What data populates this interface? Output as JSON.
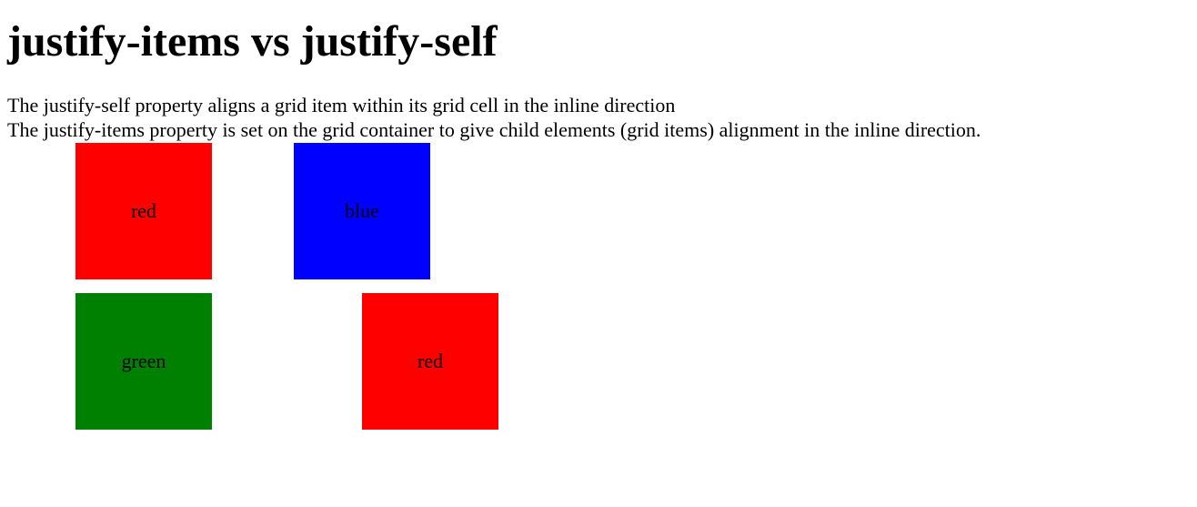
{
  "page": {
    "heading": "justify-items vs justify-self",
    "descriptions": {
      "justify_self": "The justify-self property aligns a grid item within its grid cell in the inline direction",
      "justify_items": "The justify-items property is set on the grid container to give child elements (grid items) alignment in the inline direction."
    }
  },
  "grid": {
    "items": [
      {
        "label": "red",
        "color": "#ff0000"
      },
      {
        "label": "blue",
        "color": "#0000ff"
      },
      {
        "label": "green",
        "color": "#008000"
      },
      {
        "label": "red",
        "color": "#ff0000"
      }
    ]
  }
}
